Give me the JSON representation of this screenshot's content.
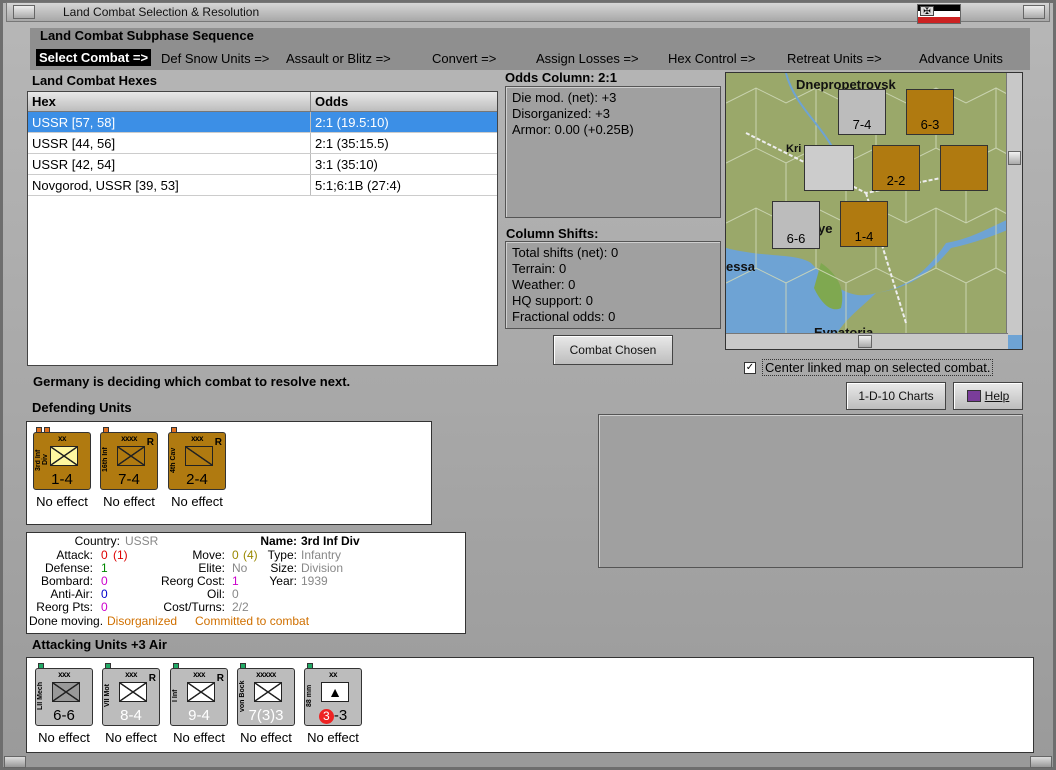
{
  "window": {
    "title": "Land Combat Selection & Resolution"
  },
  "subphase": {
    "heading": "Land Combat Subphase Sequence",
    "items": [
      "Select Combat =>",
      "Def Snow Units =>",
      "Assault or Blitz =>",
      "Convert =>",
      "Assign Losses =>",
      "Hex Control =>",
      "Retreat Units =>",
      "Advance Units"
    ]
  },
  "hexes": {
    "heading": "Land Combat Hexes",
    "columns": [
      "Hex",
      "Odds"
    ],
    "rows": [
      {
        "hex": "USSR [57, 58]",
        "odds": "2:1 (19.5:10)"
      },
      {
        "hex": "USSR [44, 56]",
        "odds": "2:1 (35:15.5)"
      },
      {
        "hex": "USSR [42, 54]",
        "odds": "3:1 (35:10)"
      },
      {
        "hex": "Novgorod, USSR [39, 53]",
        "odds": "5:1;6:1B (27:4)"
      }
    ]
  },
  "odds": {
    "heading": "Odds Column: 2:1",
    "lines": [
      "Die mod. (net): +3",
      "Disorganized: +3",
      "Armor: 0.00 (+0.25B)"
    ]
  },
  "shifts": {
    "heading": "Column Shifts:",
    "lines": [
      "Total shifts (net): 0",
      "Terrain: 0",
      "Weather: 0",
      "HQ support: 0",
      "Fractional odds: 0"
    ]
  },
  "buttons": {
    "combat_chosen": "Combat Chosen",
    "charts": "1-D-10 Charts",
    "help": "Help"
  },
  "map": {
    "labels": [
      "Dnepropetrovsk",
      "Kri",
      "ye",
      "essa",
      "Evpatoria"
    ],
    "center_linked": "Center linked map on selected combat."
  },
  "status": "Germany is deciding which combat to resolve next.",
  "defending": {
    "heading": "Defending Units",
    "units": [
      {
        "size": "xx",
        "name": "3rd Inf Div",
        "stat": "1-4",
        "effect": "No effect"
      },
      {
        "size": "xxxx",
        "name": "16th Inf",
        "stat": "7-4",
        "effect": "No effect"
      },
      {
        "size": "xxx",
        "name": "4th Cav",
        "stat": "2-4",
        "effect": "No effect"
      }
    ]
  },
  "details": {
    "country_label": "Country:",
    "country": "USSR",
    "attack_label": "Attack:",
    "attack": "0",
    "attack_mod": "(1)",
    "defense_label": "Defense:",
    "defense": "1",
    "bombard_label": "Bombard:",
    "bombard": "0",
    "antiair_label": "Anti-Air:",
    "antiair": "0",
    "reorg_pts_label": "Reorg Pts:",
    "reorg_pts": "0",
    "status_line": "Done moving.",
    "disorganized": "Disorganized",
    "committed": "Committed to combat",
    "move_label": "Move:",
    "move": "0",
    "move_mod": "(4)",
    "elite_label": "Elite:",
    "elite": "No",
    "reorg_cost_label": "Reorg Cost:",
    "reorg_cost": "1",
    "oil_label": "Oil:",
    "oil": "0",
    "cost_turns_label": "Cost/Turns:",
    "cost_turns": "2/2",
    "name_label": "Name:",
    "name": "3rd Inf Div",
    "type_label": "Type:",
    "type": "Infantry",
    "size_label": "Size:",
    "size": "Division",
    "year_label": "Year:",
    "year": "1939"
  },
  "attacking": {
    "heading": "Attacking Units +3 Air",
    "units": [
      {
        "size": "xxx",
        "name": "LII Mech",
        "stat": "6-6",
        "effect": "No effect"
      },
      {
        "size": "xxx",
        "name": "VII Mot",
        "stat": "8-4",
        "effect": "No effect"
      },
      {
        "size": "xxx",
        "name": "I Inf",
        "stat": "9-4",
        "effect": "No effect"
      },
      {
        "size": "xxxxx",
        "name": "von Bock",
        "stat": "7(3)3",
        "effect": "No effect"
      },
      {
        "size": "xx",
        "name": "88 mm",
        "stat_circle": "3",
        "stat": "-3",
        "effect": "No effect"
      }
    ]
  },
  "colors": {
    "selected_row": "#3c8fe6",
    "ussr_counter": "#b07a10",
    "german_counter": "#bcbcbc"
  }
}
